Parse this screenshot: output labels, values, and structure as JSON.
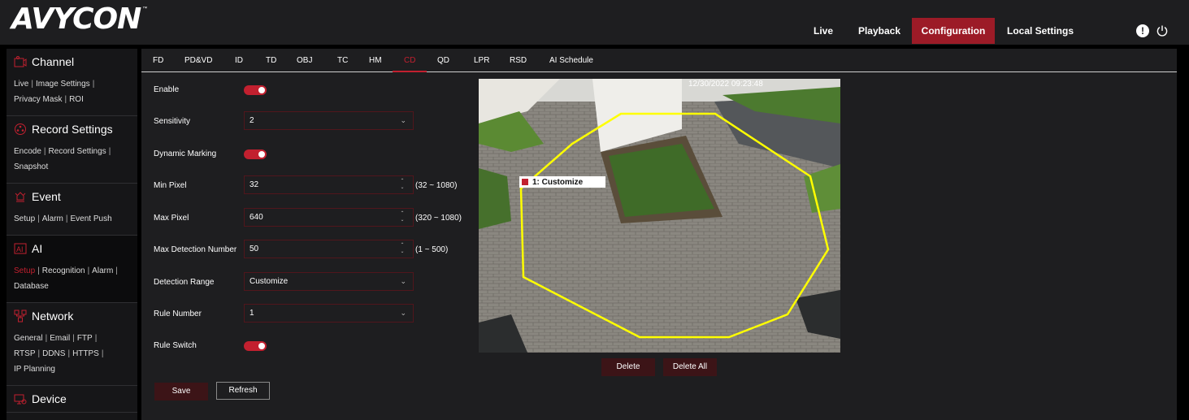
{
  "brand": {
    "logo_text": "AVYCON",
    "logo_mark": "™"
  },
  "topnav": {
    "items": [
      {
        "label": "Live"
      },
      {
        "label": "Playback"
      },
      {
        "label": "Configuration"
      },
      {
        "label": "Local Settings"
      }
    ],
    "active_index": 2,
    "icons": [
      "info-icon",
      "power-icon"
    ],
    "info_glyph": "!"
  },
  "sidebar": {
    "sections": [
      {
        "title": "Channel",
        "icon": "channel-icon",
        "links": [
          "Live",
          "Image Settings",
          "Privacy Mask",
          "ROI"
        ]
      },
      {
        "title": "Record Settings",
        "icon": "record-icon",
        "links": [
          "Encode",
          "Record Settings",
          "Snapshot"
        ]
      },
      {
        "title": "Event",
        "icon": "event-icon",
        "links": [
          "Setup",
          "Alarm",
          "Event Push"
        ]
      },
      {
        "title": "AI",
        "icon": "ai-icon",
        "links": [
          "Setup",
          "Recognition",
          "Alarm",
          "Database"
        ],
        "active": true
      },
      {
        "title": "Network",
        "icon": "network-icon",
        "links": [
          "General",
          "Email",
          "FTP",
          "RTSP",
          "DDNS",
          "HTTPS",
          "IP Planning"
        ]
      },
      {
        "title": "Device",
        "icon": "device-icon",
        "links": []
      }
    ]
  },
  "tabs": {
    "items": [
      "FD",
      "PD&VD",
      "ID",
      "TD",
      "OBJ",
      "TC",
      "HM",
      "CD",
      "QD",
      "LPR",
      "RSD",
      "AI Schedule"
    ],
    "active_index": 7
  },
  "form": {
    "enable_label": "Enable",
    "enable_on": true,
    "sensitivity_label": "Sensitivity",
    "sensitivity_value": "2",
    "dynamic_marking_label": "Dynamic Marking",
    "dynamic_marking_on": true,
    "min_pixel_label": "Min Pixel",
    "min_pixel_value": "32",
    "min_pixel_range": "(32 ~ 1080)",
    "max_pixel_label": "Max Pixel",
    "max_pixel_value": "640",
    "max_pixel_range": "(320 ~ 1080)",
    "max_detection_label": "Max Detection Number",
    "max_detection_value": "50",
    "max_detection_range": "(1 ~ 500)",
    "detection_range_label": "Detection Range",
    "detection_range_value": "Customize",
    "rule_number_label": "Rule Number",
    "rule_number_value": "1",
    "rule_switch_label": "Rule Switch",
    "rule_switch_on": true
  },
  "buttons": {
    "save": "Save",
    "refresh": "Refresh",
    "delete": "Delete",
    "delete_all": "Delete All"
  },
  "camera": {
    "timestamp": "12/30/2022 09:23:48",
    "region_label": "1: Customize",
    "region_color": "#ffff00"
  },
  "colors": {
    "accent": "#c2202f",
    "active_tab_bg": "#9c1b27",
    "panel_bg": "#1e1e20",
    "button_bg": "#3c1417"
  }
}
